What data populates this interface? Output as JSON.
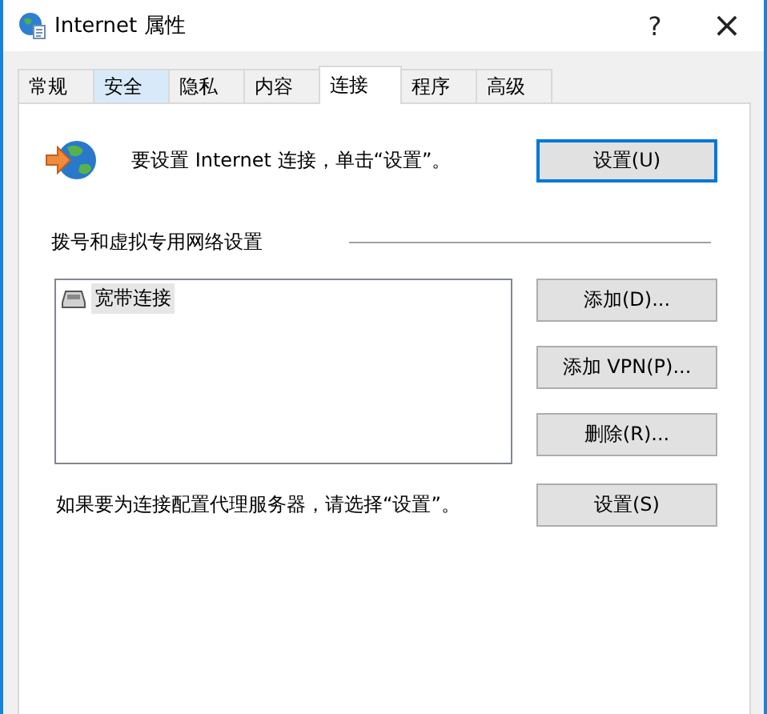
{
  "window": {
    "title": "Internet 属性",
    "help": "?",
    "close": "×"
  },
  "tabs": [
    {
      "label": "常规",
      "selected": false,
      "hovered": false
    },
    {
      "label": "安全",
      "selected": false,
      "hovered": true
    },
    {
      "label": "隐私",
      "selected": false,
      "hovered": false
    },
    {
      "label": "内容",
      "selected": false,
      "hovered": false
    },
    {
      "label": "连接",
      "selected": true,
      "hovered": false
    },
    {
      "label": "程序",
      "selected": false,
      "hovered": false
    },
    {
      "label": "高级",
      "selected": false,
      "hovered": false
    }
  ],
  "setup": {
    "text": "要设置 Internet 连接，单击“设置”。",
    "button": {
      "label": "设置(U)",
      "focused": true
    }
  },
  "dialup": {
    "heading": "拨号和虚拟专用网络设置",
    "connections": [
      {
        "label": "宽带连接",
        "selected": true
      }
    ],
    "buttons": [
      {
        "label": "添加(D)..."
      },
      {
        "label": "添加 VPN(P)..."
      },
      {
        "label": "删除(R)..."
      }
    ]
  },
  "proxy": {
    "text": "如果要为连接配置代理服务器，请选择“设置”。",
    "button": {
      "label": "设置(S)"
    }
  }
}
